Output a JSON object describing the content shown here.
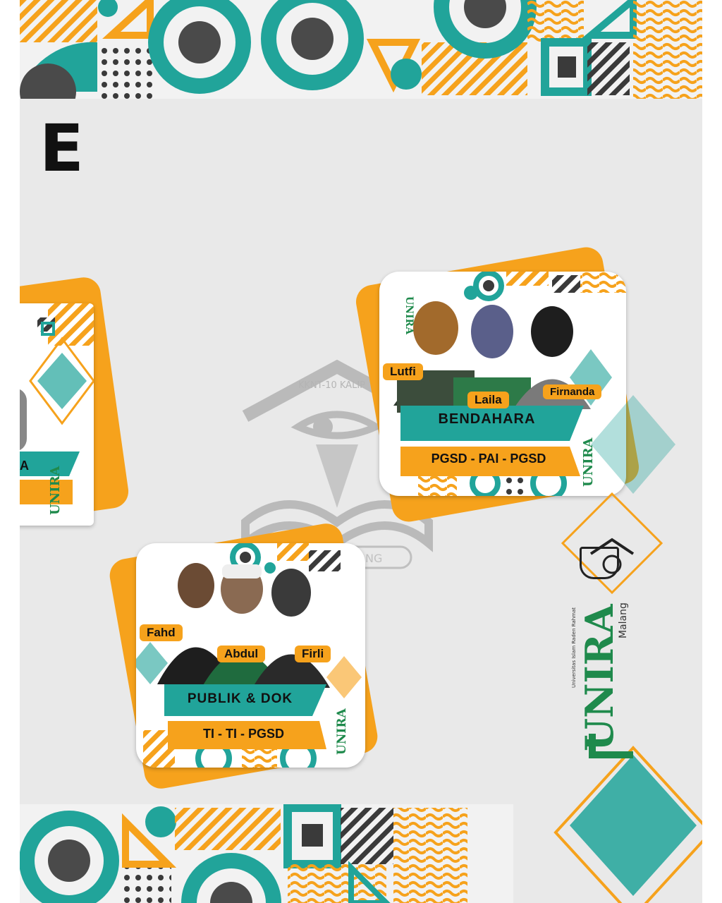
{
  "heading": {
    "letter": "E"
  },
  "watermark": {
    "text": "KKNT-10 KALIP",
    "badge": "NG"
  },
  "logo": {
    "brand": "UNIRA",
    "city": "Malang",
    "small": "Universitas Islam Raden Rahmat"
  },
  "left_card": {
    "role_fragment": "A"
  },
  "cards": [
    {
      "id": "bendahara",
      "role": "BENDAHARA",
      "prodi": "PGSD - PAI - PGSD",
      "members": [
        "Lutfi",
        "Laila",
        "Firnanda"
      ]
    },
    {
      "id": "publik-dok",
      "role": "PUBLIK & DOK",
      "prodi": "TI - TI - PGSD",
      "members": [
        "Fahd",
        "Abdul",
        "Firli"
      ]
    }
  ],
  "colors": {
    "teal": "#21a49a",
    "orange": "#f6a21c",
    "dark": "#4a4a4a",
    "green": "#1f8a4c"
  }
}
